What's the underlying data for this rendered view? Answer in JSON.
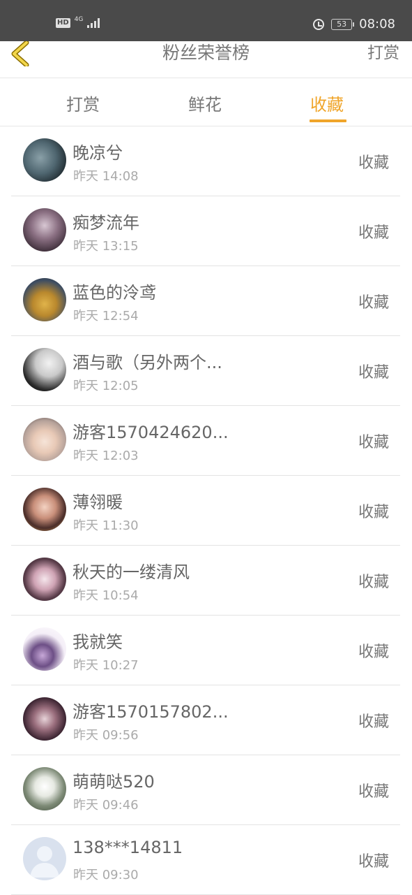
{
  "status_bar": {
    "hd": "HD",
    "network": "4G",
    "battery": "53",
    "time": "08:08"
  },
  "header": {
    "title": "粉丝荣誉榜",
    "right_action": "打赏",
    "back_icon": "chevron-left-icon"
  },
  "tabs": [
    {
      "label": "打赏",
      "active": false
    },
    {
      "label": "鲜花",
      "active": false
    },
    {
      "label": "收藏",
      "active": true
    }
  ],
  "colors": {
    "accent": "#f0a52a",
    "status_bar": "#4a4a4a"
  },
  "fans": [
    {
      "name": "晚凉兮",
      "time": "昨天 14:08",
      "action": "收藏"
    },
    {
      "name": "痴梦流年",
      "time": "昨天 13:15",
      "action": "收藏"
    },
    {
      "name": "蓝色的泠鸢",
      "time": "昨天 12:54",
      "action": "收藏"
    },
    {
      "name": "酒与歌（另外两个...",
      "time": "昨天 12:05",
      "action": "收藏"
    },
    {
      "name": "游客1570424620...",
      "time": "昨天 12:03",
      "action": "收藏"
    },
    {
      "name": "薄翎暖",
      "time": "昨天 11:30",
      "action": "收藏"
    },
    {
      "name": "秋天的一缕清风",
      "time": "昨天 10:54",
      "action": "收藏"
    },
    {
      "name": "我就笑",
      "time": "昨天 10:27",
      "action": "收藏"
    },
    {
      "name": "游客1570157802...",
      "time": "昨天 09:56",
      "action": "收藏"
    },
    {
      "name": "萌萌哒520",
      "time": "昨天 09:46",
      "action": "收藏"
    },
    {
      "name": "138***14811",
      "time": "昨天 09:30",
      "action": "收藏"
    }
  ]
}
